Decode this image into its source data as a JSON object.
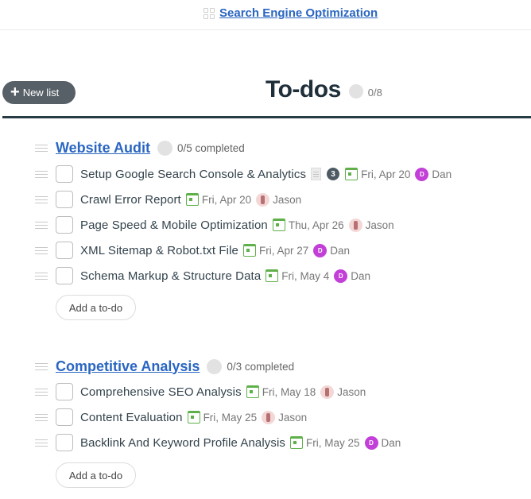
{
  "header": {
    "project_icon": "grid-icon",
    "project_title": "Search Engine Optimization"
  },
  "toolbar": {
    "new_list_label": "New list",
    "new_list_icon": "plus-icon"
  },
  "page": {
    "title": "To-dos",
    "progress": "0/8"
  },
  "lists": [
    {
      "title": "Website Audit",
      "completed": "0/5 completed",
      "add_label": "Add a to-do",
      "todos": [
        {
          "title": "Setup Google Search Console & Analytics",
          "has_notes": true,
          "comments": "3",
          "date": "Fri, Apr 20",
          "assignee": "Dan",
          "avatar_initial": "D"
        },
        {
          "title": "Crawl Error Report",
          "date": "Fri, Apr 20",
          "assignee": "Jason"
        },
        {
          "title": "Page Speed & Mobile Optimization",
          "date": "Thu, Apr 26",
          "assignee": "Jason"
        },
        {
          "title": "XML Sitemap & Robot.txt File",
          "date": "Fri, Apr 27",
          "assignee": "Dan",
          "avatar_initial": "D"
        },
        {
          "title": "Schema Markup & Structure Data",
          "date": "Fri, May 4",
          "assignee": "Dan",
          "avatar_initial": "D"
        }
      ]
    },
    {
      "title": "Competitive Analysis",
      "completed": "0/3 completed",
      "add_label": "Add a to-do",
      "todos": [
        {
          "title": "Comprehensive SEO Analysis",
          "date": "Fri, May 18",
          "assignee": "Jason"
        },
        {
          "title": "Content Evaluation",
          "date": "Fri, May 25",
          "assignee": "Jason"
        },
        {
          "title": "Backlink And Keyword Profile Analysis",
          "date": "Fri, May 25",
          "assignee": "Dan",
          "avatar_initial": "D"
        }
      ]
    }
  ],
  "colors": {
    "link": "#2a66c2",
    "dark": "#283c46",
    "calendar": "#5fb04a",
    "dan_avatar": "#c23fd8",
    "new_list_bg": "#576067"
  }
}
